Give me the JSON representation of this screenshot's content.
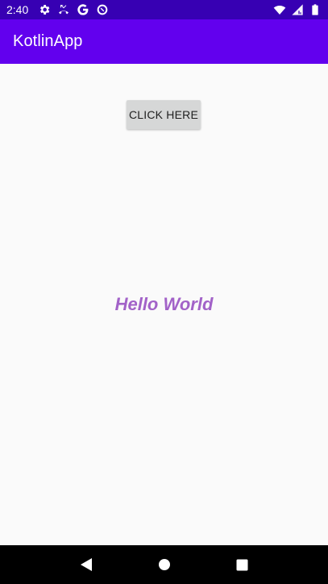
{
  "status_bar": {
    "time": "2:40",
    "icons_left": [
      "settings-icon",
      "missed-call-icon",
      "google-icon",
      "data-saver-icon"
    ],
    "icons_right": [
      "wifi-icon",
      "signal-icon",
      "battery-icon"
    ]
  },
  "app_bar": {
    "title": "KotlinApp",
    "background": "#6200ee"
  },
  "main": {
    "button_label": "CLICK HERE",
    "hello_text": "Hello World",
    "hello_color": "#a262c8"
  },
  "nav_bar": {
    "buttons": [
      "back-icon",
      "home-icon",
      "recents-icon"
    ]
  },
  "colors": {
    "status_bar": "#3700b3",
    "app_bar": "#6200ee",
    "background": "#fafafa",
    "button": "#d6d7d7"
  }
}
